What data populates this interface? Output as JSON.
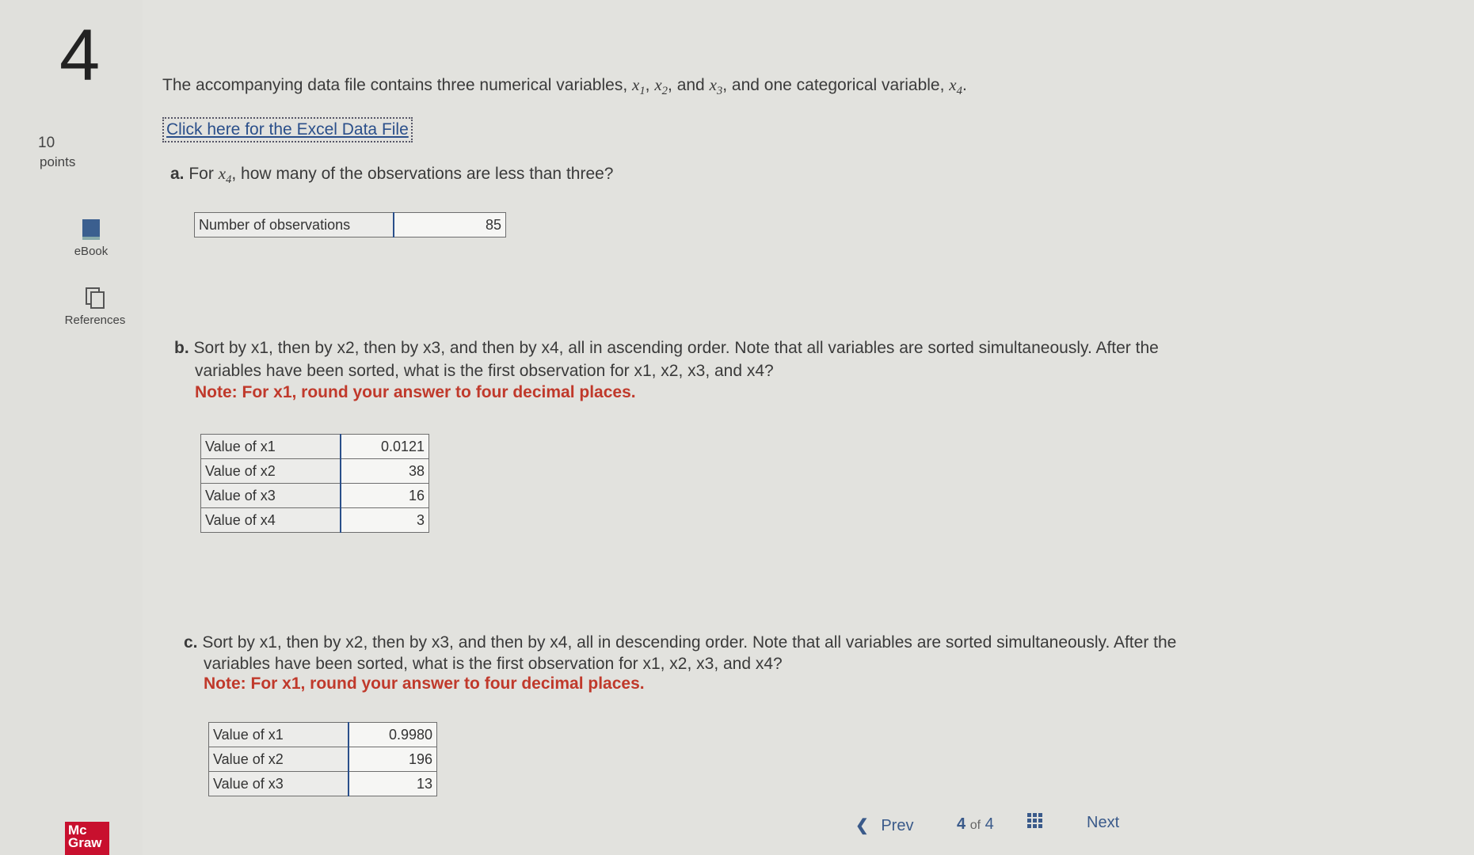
{
  "question": {
    "number": "4",
    "points_value": "10",
    "points_label": "points"
  },
  "tools": {
    "ebook": "eBook",
    "references": "References"
  },
  "intro": {
    "text_start": "The accompanying data file contains three numerical variables,",
    "and": "and",
    "text_end": ", and one categorical variable,"
  },
  "excel_link": "Click here for the Excel Data File",
  "part_a": {
    "label": "a.",
    "text_start": "For",
    "text_end": ", how many of the observations are less than three?",
    "row_label": "Number of observations",
    "value": "85"
  },
  "part_b": {
    "label": "b.",
    "line1": "Sort by x1, then by x2, then by x3, and then by x4, all in ascending order. Note that all variables are sorted simultaneously. After the",
    "line2": "variables have been sorted, what is the first observation for x1, x2, x3, and x4?",
    "note": "Note: For x1, round your answer to four decimal places.",
    "rows": [
      {
        "label": "Value of x1",
        "value": "0.0121"
      },
      {
        "label": "Value of x2",
        "value": "38"
      },
      {
        "label": "Value of x3",
        "value": "16"
      },
      {
        "label": "Value of x4",
        "value": "3"
      }
    ]
  },
  "part_c": {
    "label": "c.",
    "line1": "Sort by x1, then by x2, then by x3, and then by x4, all in descending order. Note that all variables are sorted simultaneously. After the",
    "line2": "variables have been sorted, what is the first observation for x1, x2, x3, and x4?",
    "note": "Note: For x1, round your answer to four decimal places.",
    "rows": [
      {
        "label": "Value of x1",
        "value": "0.9980"
      },
      {
        "label": "Value of x2",
        "value": "196"
      },
      {
        "label": "Value of x3",
        "value": "13"
      }
    ]
  },
  "footer": {
    "prev": "Prev",
    "current": "4",
    "of": "of",
    "total": "4",
    "next": "Next"
  },
  "brand": {
    "logo_line1": "Mc",
    "logo_line2": "Graw"
  }
}
